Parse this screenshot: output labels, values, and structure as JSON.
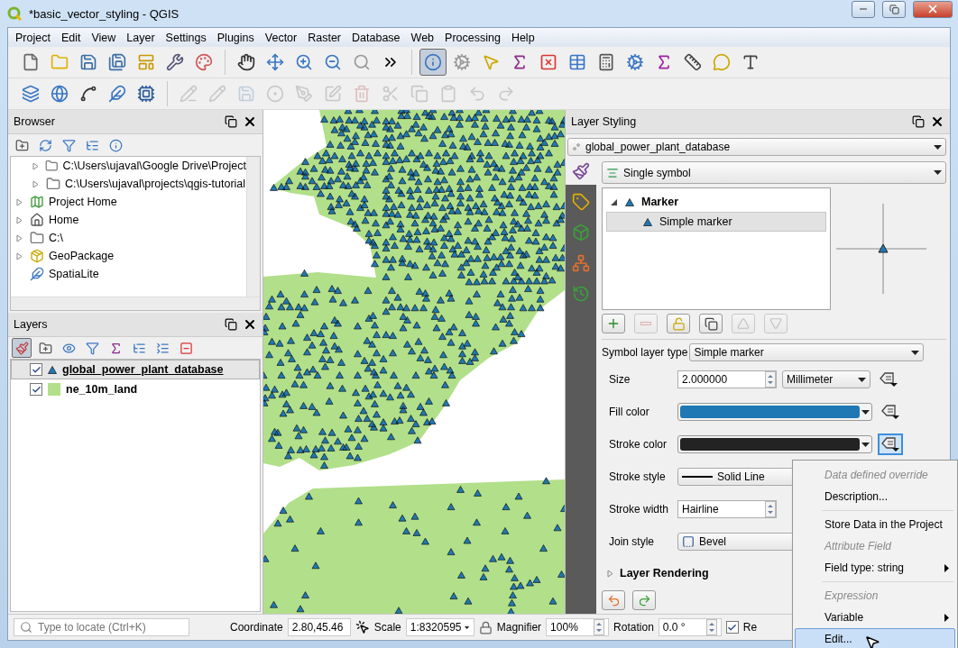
{
  "window": {
    "title": "*basic_vector_styling - QGIS"
  },
  "menu": [
    "Project",
    "Edit",
    "View",
    "Layer",
    "Settings",
    "Plugins",
    "Vector",
    "Raster",
    "Database",
    "Web",
    "Processing",
    "Help"
  ],
  "toolbars": [
    [
      [
        {
          "kind": "new",
          "pressed": false
        },
        {
          "kind": "open",
          "pressed": false
        },
        {
          "kind": "save",
          "pressed": false
        },
        {
          "kind": "save_as",
          "pressed": false
        },
        {
          "kind": "layout",
          "pressed": false
        },
        {
          "kind": "layout_manager",
          "pressed": false
        },
        {
          "kind": "style_manager",
          "pressed": false
        }
      ],
      [
        {
          "kind": "pan",
          "pressed": false
        },
        {
          "kind": "pan_selection",
          "pressed": false
        },
        {
          "kind": "zoom_in",
          "pressed": false
        },
        {
          "kind": "zoom_out",
          "pressed": false
        },
        {
          "kind": "zoom_native",
          "pressed": false
        },
        {
          "kind": "more",
          "pressed": false
        }
      ],
      [
        {
          "kind": "identify",
          "pressed": true
        },
        {
          "kind": "action",
          "pressed": false
        },
        {
          "kind": "select",
          "pressed": false
        },
        {
          "kind": "select_expression",
          "pressed": false
        },
        {
          "kind": "deselect",
          "pressed": false
        },
        {
          "kind": "table",
          "pressed": false
        },
        {
          "kind": "calculator",
          "pressed": false
        },
        {
          "kind": "toolbox",
          "pressed": false
        },
        {
          "kind": "statistics",
          "pressed": false
        },
        {
          "kind": "measure",
          "pressed": false
        },
        {
          "kind": "tips",
          "pressed": false
        },
        {
          "kind": "text",
          "pressed": false
        }
      ]
    ],
    [
      [
        {
          "kind": "add_layer",
          "disabled": false
        },
        {
          "kind": "add_wms",
          "disabled": false
        },
        {
          "kind": "new_vertex",
          "disabled": false
        },
        {
          "kind": "new_spatialite",
          "disabled": false
        },
        {
          "kind": "gps",
          "disabled": false
        }
      ],
      [
        {
          "kind": "edits",
          "disabled": true
        },
        {
          "kind": "toggle_edit",
          "disabled": true
        },
        {
          "kind": "save",
          "disabled": true
        },
        {
          "kind": "add_point",
          "disabled": true
        },
        {
          "kind": "vertex_tool",
          "disabled": true
        },
        {
          "kind": "modify",
          "disabled": true
        },
        {
          "kind": "delete",
          "disabled": true
        },
        {
          "kind": "cut",
          "disabled": true
        },
        {
          "kind": "copy",
          "disabled": true
        },
        {
          "kind": "paste",
          "disabled": true
        },
        {
          "kind": "undo",
          "disabled": true
        },
        {
          "kind": "redo",
          "disabled": true
        }
      ]
    ]
  ],
  "browser": {
    "title": "Browser",
    "items": [
      {
        "children": [
          {
            "label": "C:\\Users\\ujaval\\Google Drive\\Project",
            "kind": "folder",
            "expandable": true
          },
          {
            "label": "C:\\Users\\ujaval\\projects\\qgis-tutorial",
            "kind": "folder",
            "expandable": true
          }
        ]
      },
      {
        "label": "Project Home",
        "kind": "project",
        "expandable": true
      },
      {
        "label": "Home",
        "kind": "home",
        "expandable": true
      },
      {
        "label": "C:\\",
        "kind": "folder",
        "expandable": true
      },
      {
        "label": "GeoPackage",
        "kind": "geopackage",
        "expandable": true
      },
      {
        "label": "SpatiaLite",
        "kind": "spatialite",
        "expandable": false
      }
    ]
  },
  "layers": {
    "title": "Layers",
    "tools": [
      {
        "kind": "style",
        "pressed": true
      },
      {
        "kind": "add_group",
        "pressed": false
      },
      {
        "kind": "visibility",
        "pressed": false
      },
      {
        "kind": "filter",
        "pressed": false
      },
      {
        "kind": "expression",
        "pressed": false
      },
      {
        "kind": "expand",
        "pressed": false
      },
      {
        "kind": "collapse",
        "pressed": false
      },
      {
        "kind": "remove",
        "pressed": false
      }
    ],
    "items": [
      {
        "name": "global_power_plant_database",
        "kind": "point",
        "checked": true,
        "selected": true
      },
      {
        "name": "ne_10m_land",
        "kind": "fill",
        "checked": true,
        "selected": false
      }
    ]
  },
  "styling": {
    "title": "Layer Styling",
    "layer": "global_power_plant_database",
    "renderer": "Single symbol",
    "side_tabs": [
      {
        "kind": "symbology",
        "selected": true
      },
      {
        "kind": "labels",
        "selected": false
      },
      {
        "kind": "scene",
        "selected": false
      },
      {
        "kind": "diagrams",
        "selected": false
      },
      {
        "kind": "history",
        "selected": false
      }
    ],
    "symbol_tree": [
      {
        "label": "Marker",
        "expanded": true,
        "children": [
          {
            "label": "Simple marker",
            "selected": true
          }
        ]
      }
    ],
    "symbol_layer_type_label": "Symbol layer type",
    "symbol_layer_type": "Simple marker",
    "properties": [
      {
        "kind": "spin",
        "label": "Size",
        "value": "2.000000",
        "unit": "Millimeter",
        "focused": false
      },
      {
        "kind": "color",
        "label": "Fill color",
        "color": "#1f78b4",
        "focused": false
      },
      {
        "kind": "color",
        "label": "Stroke color",
        "color": "#232323",
        "focused": true
      },
      {
        "kind": "line",
        "label": "Stroke style",
        "value": "Solid Line"
      },
      {
        "kind": "spin",
        "label": "Stroke width",
        "value": "Hairline"
      },
      {
        "kind": "join",
        "label": "Join style",
        "value": "Bevel"
      }
    ],
    "section": {
      "label": "Layer Rendering",
      "expanded": false
    }
  },
  "context_menu": [
    {
      "kind": "header",
      "label": "Data defined override",
      "hovered": false
    },
    {
      "kind": "item",
      "label": "Description...",
      "hovered": false
    },
    {
      "kind": "separator"
    },
    {
      "kind": "item",
      "label": "Store Data in the Project",
      "hovered": false
    },
    {
      "kind": "header",
      "label": "Attribute Field",
      "hovered": false
    },
    {
      "kind": "submenu",
      "label": "Field type: string",
      "hovered": false
    },
    {
      "kind": "separator"
    },
    {
      "kind": "header",
      "label": "Expression",
      "hovered": false
    },
    {
      "kind": "submenu",
      "label": "Variable",
      "hovered": false
    },
    {
      "kind": "item",
      "label": "Edit...",
      "hovered": true
    }
  ],
  "status_bar": {
    "locator_placeholder": "Type to locate (Ctrl+K)",
    "coordinate_label": "Coordinate",
    "coordinate": "2.80,45.46",
    "scale_label": "Scale",
    "scale": "1:8320595",
    "magnifier_label": "Magnifier",
    "magnifier": "100%",
    "rotation_label": "Rotation",
    "rotation": "0.0 °",
    "render": {
      "label": "Re",
      "checked": true
    }
  }
}
